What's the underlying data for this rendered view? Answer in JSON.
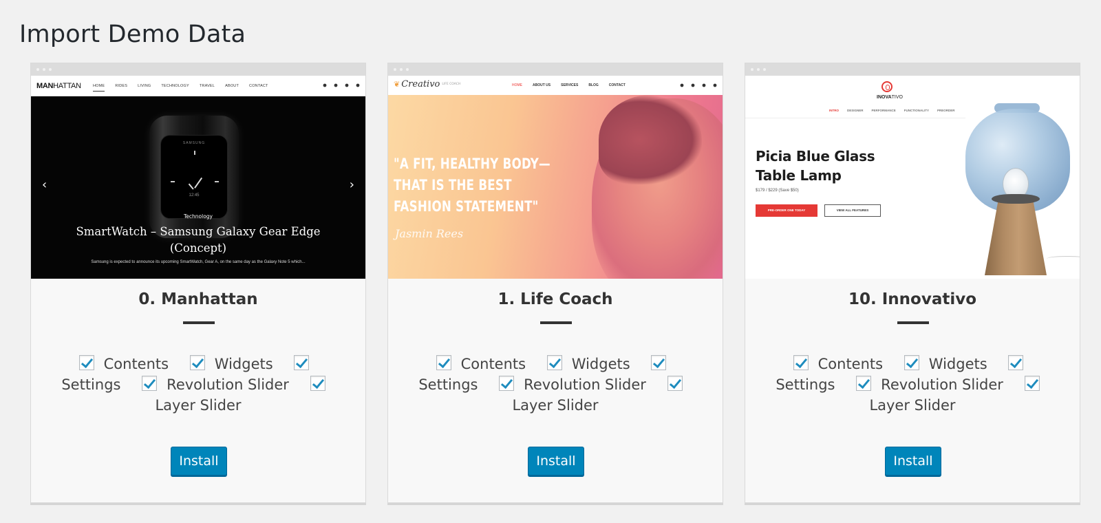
{
  "page": {
    "title": "Import Demo Data"
  },
  "option_labels": {
    "contents": "Contents",
    "widgets": "Widgets",
    "settings": "Settings",
    "revolution_slider": "Revolution Slider",
    "layer_slider": "Layer Slider"
  },
  "colors": {
    "accent": "#0085ba",
    "checkmark": "#1e8cbe",
    "background": "#f1f1f1"
  },
  "demos": [
    {
      "name": "0. Manhattan",
      "install_label": "Install",
      "options_checked": {
        "contents": true,
        "widgets": true,
        "settings": true,
        "revolution_slider": true,
        "layer_slider": true
      },
      "preview": {
        "logo_bold": "MAN",
        "logo_rest": "HATTAN",
        "menu": [
          "HOME",
          "RIDES",
          "LIVING",
          "TECHNOLOGY",
          "TRAVEL",
          "ABOUT",
          "CONTACT"
        ],
        "watch_brand": "SAMSUNG",
        "watch_time": "12:45",
        "slide_tag": "Technology",
        "slide_title": "SmartWatch – Samsung Galaxy Gear Edge (Concept)",
        "slide_desc": "Samsung is expected to announce its upcoming SmartWatch, Gear A, on the same day as the Galaxy Note 5 which..."
      }
    },
    {
      "name": "1. Life Coach",
      "install_label": "Install",
      "options_checked": {
        "contents": true,
        "widgets": true,
        "settings": true,
        "revolution_slider": true,
        "layer_slider": true
      },
      "preview": {
        "logo": "Creativo",
        "logo_sub": "LIFE COACH",
        "menu": [
          "HOME",
          "ABOUT US",
          "SERVICES",
          "BLOG",
          "CONTACT"
        ],
        "quote": "\"A FIT, HEALTHY BODY—THAT IS THE BEST FASHION STATEMENT\"",
        "signature": "Jasmin Rees"
      }
    },
    {
      "name": "10. Innovativo",
      "install_label": "Install",
      "options_checked": {
        "contents": true,
        "widgets": true,
        "settings": true,
        "revolution_slider": true,
        "layer_slider": true
      },
      "preview": {
        "logo_bold": "INOVA",
        "logo_rest": "TIVO",
        "menu": [
          "INTRO",
          "DESIGNER",
          "PERFORMANCE",
          "FUNCTIONALITY",
          "PREORDER"
        ],
        "title_line1": "Picia Blue Glass",
        "title_line2": "Table Lamp",
        "price": "$179 / $229 (Save $50)",
        "primary_button": "PRE-ORDER ONE TODAY",
        "secondary_button": "VIEW ALL FEATURES"
      }
    }
  ]
}
